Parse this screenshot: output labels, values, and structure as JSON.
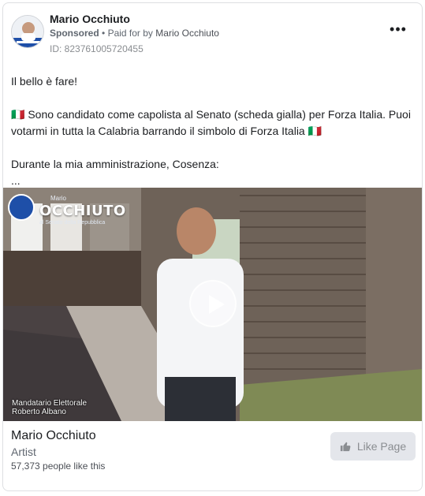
{
  "ad": {
    "advertiser_name": "Mario Occhiuto",
    "sponsored_label": "Sponsored",
    "separator": "•",
    "paid_for_prefix": "Paid for by",
    "paid_for_name": "Mario Occhiuto",
    "id_label": "ID: 823761005720455",
    "more_icon": "more-horizontal-icon"
  },
  "body": {
    "line1": "Il bello è fare!",
    "line2": "🇮🇹 Sono candidato come capolista al Senato (scheda gialla) per Forza Italia. Puoi votarmi in tutta la Calabria barrando il simbolo di Forza Italia 🇮🇹",
    "line3": "Durante la mia amministrazione, Cosenza:",
    "line4": "..."
  },
  "video": {
    "logo_prefix": "Mario",
    "logo_word": "OCCHIUTO",
    "logo_subtitle": "al Senato della Repubblica",
    "caption_line1": "Mandatario Elettorale",
    "caption_line2": "Roberto Albano",
    "play_icon": "play-icon"
  },
  "footer": {
    "page_name": "Mario Occhiuto",
    "category": "Artist",
    "likes": "57,373 people like this",
    "like_button_label": "Like Page",
    "like_icon": "thumbs-up-icon"
  },
  "colors": {
    "text_primary": "#1c1e21",
    "text_secondary": "#606770",
    "button_bg": "#e4e6eb",
    "button_text": "#8a8d91"
  }
}
